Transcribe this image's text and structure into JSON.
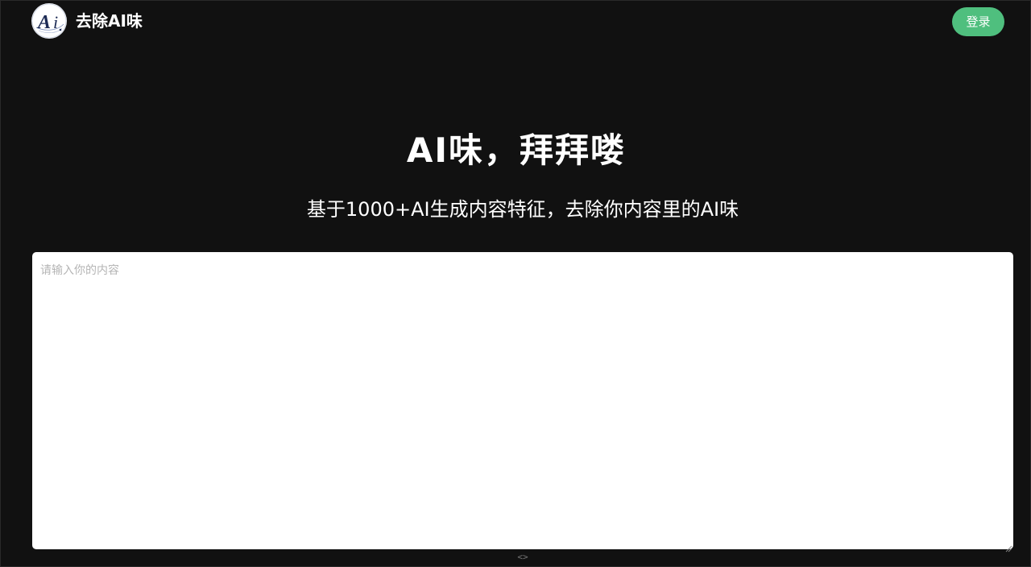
{
  "header": {
    "brand": "去除AI味",
    "logo_icon": "ai-logo-icon",
    "login_label": "登录"
  },
  "hero": {
    "title": "AI味，拜拜喽",
    "subtitle": "基于1000+AI生成内容特征，去除你内容里的AI味"
  },
  "editor": {
    "placeholder": "请输入你的内容",
    "value": ""
  },
  "footer": {
    "toggle_label": "<>"
  },
  "colors": {
    "background": "#111111",
    "accent": "#4fbf7e",
    "text": "#ffffff",
    "placeholder": "#b5b5b5"
  }
}
